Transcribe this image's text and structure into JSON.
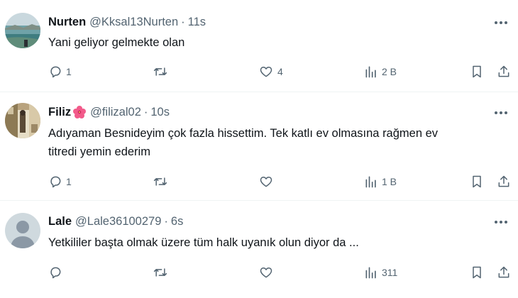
{
  "tweets": [
    {
      "name": "Nurten",
      "handle": "@Kksal13Nurten",
      "separator": "·",
      "time": "11s",
      "lines": [
        "Yani geliyor gelmekte olan"
      ],
      "replies": "1",
      "retweets": "",
      "likes": "4",
      "views": "2 B",
      "avatar": "avatar-sea-photo"
    },
    {
      "name": "Filiz",
      "name_emoji": "hibiscus-icon",
      "handle": "@filizal02",
      "separator": "·",
      "time": "10s",
      "lines": [
        "Adıyaman Besnideyim çok fazla hissettim.  Tek katlı ev olmasına rağmen ev",
        "titredi yemin ederim"
      ],
      "replies": "1",
      "retweets": "",
      "likes": "",
      "views": "1 B",
      "avatar": "avatar-photo"
    },
    {
      "name": "Lale",
      "handle": "@Lale36100279",
      "separator": "·",
      "time": "6s",
      "lines": [
        "Yetkililer başta olmak üzere tüm halk uyanık olun diyor da ..."
      ],
      "replies": "",
      "retweets": "",
      "likes": "",
      "views": "311",
      "avatar": "avatar-default"
    }
  ],
  "icons": {
    "more": "more-horizontal-icon",
    "reply": "reply-icon",
    "retweet": "retweet-icon",
    "like": "heart-icon",
    "views": "views-chart-icon",
    "bookmark": "bookmark-icon",
    "share": "share-icon"
  },
  "colors": {
    "text": "#0f1419",
    "secondary": "#536471",
    "divider": "#eff3f4",
    "hibiscus": "#f25a8a"
  }
}
